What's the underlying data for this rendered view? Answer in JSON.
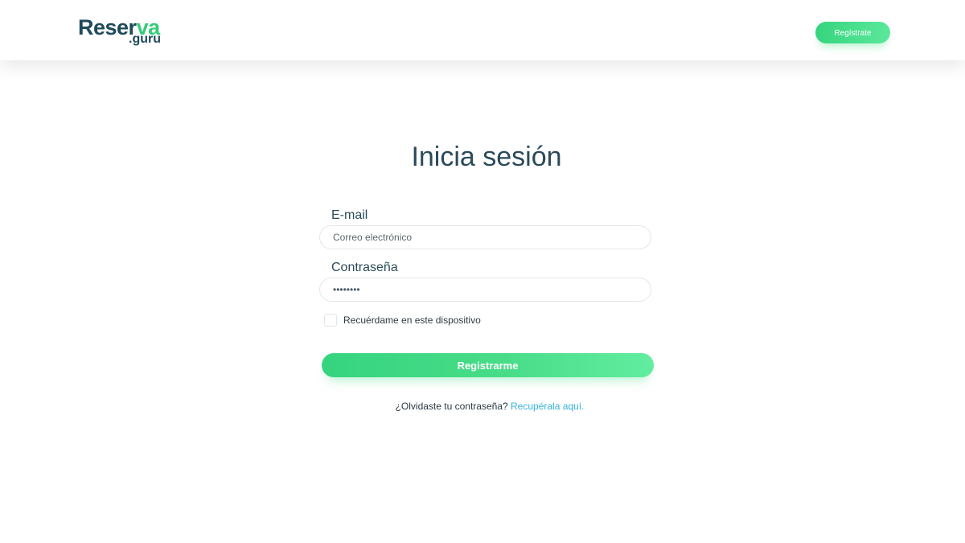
{
  "header": {
    "logo": {
      "main": "Reser",
      "accent": "va",
      "sub": ".guru"
    },
    "register_button": "Regístrate"
  },
  "login": {
    "title": "Inicia sesión",
    "email": {
      "label": "E-mail",
      "placeholder": "Correo electrónico",
      "value": ""
    },
    "password": {
      "label": "Contraseña",
      "value": "********"
    },
    "remember": {
      "label": "Recuérdame en este dispositivo",
      "checked": false
    },
    "submit_label": "Registrarme",
    "forgot": {
      "text": "¿Olvidaste tu contraseña?",
      "link": "Recupérala aquí."
    }
  },
  "colors": {
    "brand_dark": "#1f4a5c",
    "accent_green": "#36d47f",
    "link_blue": "#33b3d9"
  }
}
